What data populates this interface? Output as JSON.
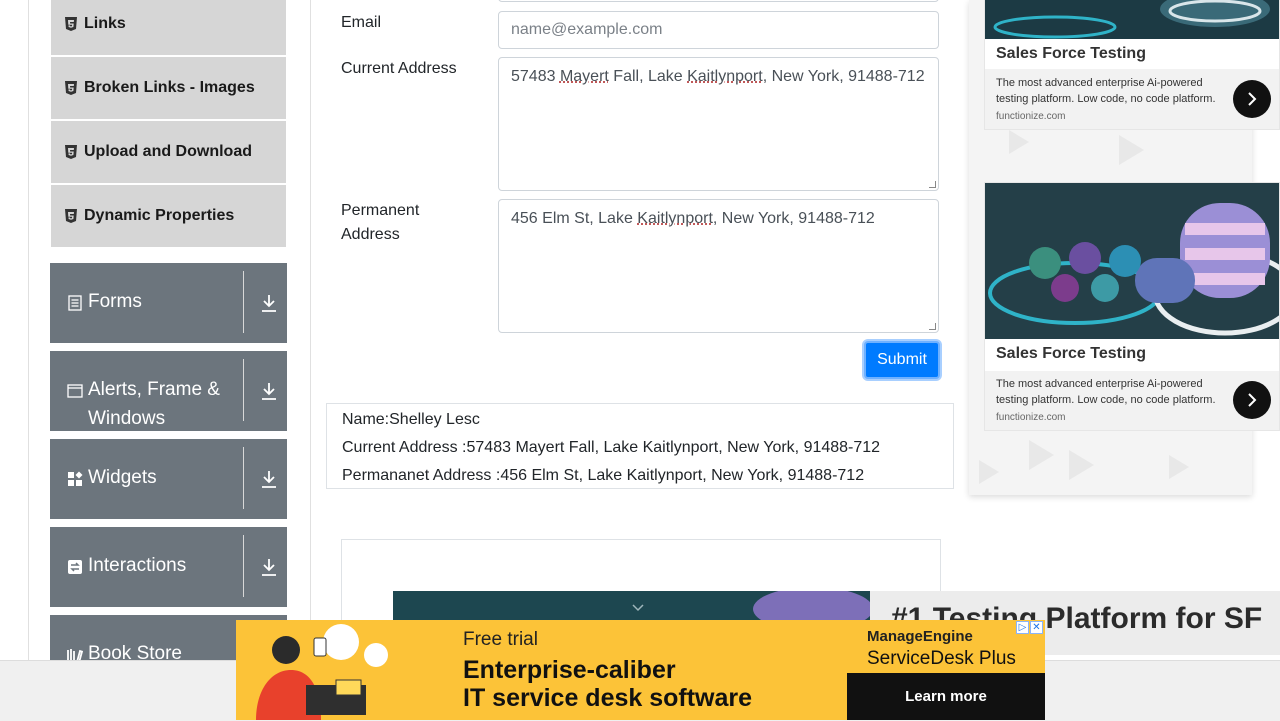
{
  "sidebar": {
    "items": [
      {
        "label": "Links"
      },
      {
        "label": "Broken Links - Images"
      },
      {
        "label": "Upload and Download"
      },
      {
        "label": "Dynamic Properties"
      }
    ],
    "groups": [
      {
        "label": "Forms",
        "icon": "form-icon"
      },
      {
        "label": "Alerts, Frame & Windows",
        "icon": "window-icon"
      },
      {
        "label": "Widgets",
        "icon": "widgets-icon"
      },
      {
        "label": "Interactions",
        "icon": "interactions-icon"
      },
      {
        "label": "Book Store",
        "icon": "book-store-icon"
      }
    ]
  },
  "form": {
    "email_label": "Email",
    "email_placeholder": "name@example.com",
    "current_address_label": "Current Address",
    "current_address_parts": [
      "57483 ",
      "Mayert",
      " Fall, Lake ",
      "Kaitlynport",
      ", New York, 91488-712"
    ],
    "permanent_address_label": "Permanent Address",
    "permanent_address_parts": [
      "456 Elm St, Lake ",
      "Kaitlynport",
      ", New York, 91488-712"
    ],
    "submit_label": "Submit"
  },
  "output": {
    "name": "Name:Shelley Lesc",
    "current_address": "Current Address :57483 Mayert Fall, Lake Kaitlynport, New York, 91488-712",
    "permanent_address": "Permananet Address :456 Elm St, Lake Kaitlynport, New York, 91488-712"
  },
  "ads": {
    "cards": [
      {
        "title": "Sales Force Testing",
        "description": "The most advanced enterprise Ai-powered testing platform. Low code, no code platform.",
        "domain": "functionize.com"
      },
      {
        "title": "Sales Force Testing",
        "description": "The most advanced enterprise Ai-powered testing platform. Low code, no code platform.",
        "domain": "functionize.com"
      }
    ],
    "promo_title": "#1 Testing Platform for SF",
    "banner": {
      "kicker": "Free trial",
      "headline_1": "Enterprise-caliber",
      "headline_2": "IT service desk software",
      "brand_1": "ManageEngine",
      "brand_2": "ServiceDesk Plus",
      "cta": "Learn more"
    }
  },
  "colors": {
    "primary": "#007bff",
    "sidebar_group_bg": "#6c757d",
    "sidebar_item_bg": "#d6d6d6",
    "banner_bg": "#fcc338"
  }
}
